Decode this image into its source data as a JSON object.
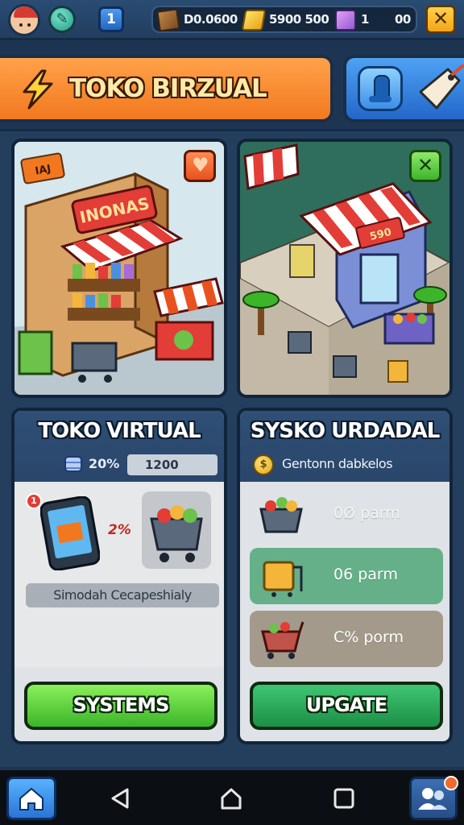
{
  "topbar": {
    "level": "1",
    "resources": [
      {
        "icon": "crate-icon",
        "value": "D0.0600"
      },
      {
        "icon": "gold-bar-icon",
        "value": "5900 500"
      },
      {
        "icon": "gem-cube-icon",
        "value": "1"
      },
      {
        "icon": "",
        "value": "00"
      }
    ]
  },
  "header": {
    "title": "TOKO BIRZUAL"
  },
  "scenes": {
    "left_sign": "INONAS",
    "left_flag": "IAJ",
    "right_sign": "590"
  },
  "panel_left": {
    "title": "TOKO VIRTUAL",
    "percent": "20%",
    "value_box": "1200",
    "badge": "1",
    "item_percent": "2%",
    "caption": "Simodah Cecapeshialy",
    "button": "SYSTEMS"
  },
  "panel_right": {
    "title": "SYSKO URDADAL",
    "subtitle": "Gentonn dabkelos",
    "rows": [
      {
        "icon": "produce-basket-icon",
        "label": "0Ø parm"
      },
      {
        "icon": "package-cart-icon",
        "label": "06 parm"
      },
      {
        "icon": "shopping-cart-icon",
        "label": "C% porm"
      }
    ],
    "button": "UPGATE"
  },
  "colors": {
    "accent_orange": "#f2781f",
    "accent_blue": "#2367c9",
    "button_green": "#3cb52a",
    "panel_navy": "#2a466a"
  }
}
